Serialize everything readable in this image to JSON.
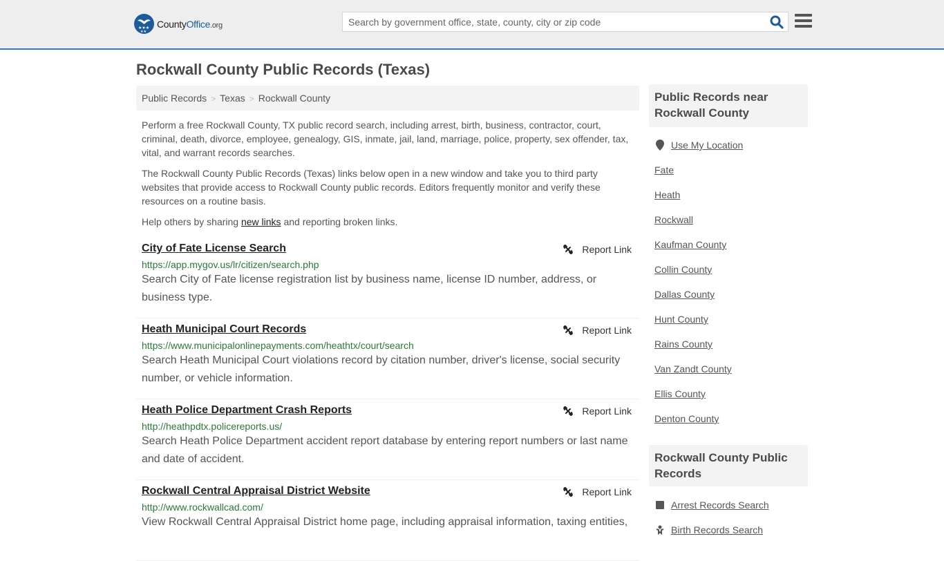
{
  "header": {
    "logo": {
      "county": "County",
      "office": "Office",
      "org": ".org"
    },
    "search_placeholder": "Search by government office, state, county, city or zip code",
    "search_icon": "search-icon",
    "menu_icon": "hamburger-menu-icon"
  },
  "page_title": "Rockwall County Public Records (Texas)",
  "breadcrumb": [
    "Public Records",
    "Texas",
    "Rockwall County"
  ],
  "intro": {
    "p1": "Perform a free Rockwall County, TX public record search, including arrest, birth, business, contractor, court, criminal, death, divorce, employee, genealogy, GIS, inmate, jail, land, marriage, police, property, sex offender, tax, vital, and warrant records searches.",
    "p2": "The Rockwall County Public Records (Texas) links below open in a new window and take you to third party websites that provide access to Rockwall County public records. Editors frequently monitor and verify these resources on a routine basis.",
    "p3_before": "Help others by sharing ",
    "p3_link": "new links",
    "p3_after": " and reporting broken links."
  },
  "report_link_label": "Report Link",
  "records": [
    {
      "title": "City of Fate License Search",
      "url": "https://app.mygov.us/lr/citizen/search.php",
      "description": "Search City of Fate license registration list by business name, license ID number, address, or business type."
    },
    {
      "title": "Heath Municipal Court Records",
      "url": "https://www.municipalonlinepayments.com/heathtx/court/search",
      "description": "Search Heath Municipal Court violations record by citation number, driver's license, social security number, or vehicle information."
    },
    {
      "title": "Heath Police Department Crash Reports",
      "url": "http://heathpdtx.policereports.us/",
      "description": "Search Heath Police Department accident report database by entering report numbers or last name and date of accident."
    },
    {
      "title": "Rockwall Central Appraisal District Website",
      "url": "http://www.rockwallcad.com/",
      "description": "View Rockwall Central Appraisal District home page, including appraisal information, taxing entities,"
    }
  ],
  "sidebar": {
    "nearby_title": "Public Records near Rockwall County",
    "use_location": "Use My Location",
    "nearby": [
      "Fate",
      "Heath",
      "Rockwall",
      "Kaufman County",
      "Collin County",
      "Dallas County",
      "Hunt County",
      "Rains County",
      "Van Zandt County",
      "Ellis County",
      "Denton County"
    ],
    "county_title": "Rockwall County Public Records",
    "county_links": [
      {
        "label": "Arrest Records Search",
        "icon": "square-icon"
      },
      {
        "label": "Birth Records Search",
        "icon": "baby-icon"
      }
    ]
  }
}
